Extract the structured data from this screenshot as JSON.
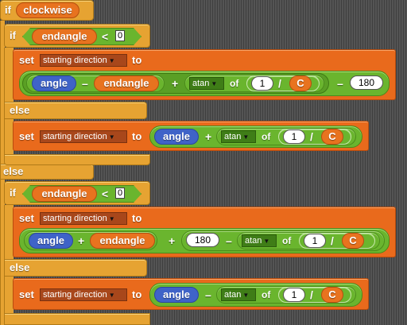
{
  "keywords": {
    "if": "if",
    "else": "else",
    "set": "set",
    "to": "to",
    "of": "of"
  },
  "operators": {
    "lt": "<",
    "minus": "–",
    "plus": "+",
    "div": "/"
  },
  "vars": {
    "clockwise": "clockwise",
    "endangle": "endangle",
    "angle": "angle",
    "c": "C"
  },
  "dropdowns": {
    "starting_direction": "starting direction",
    "atan": "atan"
  },
  "numbers": {
    "zero": "0",
    "one": "1",
    "n180": "180"
  },
  "colors": {
    "control": "#e6a332",
    "variables": "#e96a1c",
    "operators": "#6ab52e",
    "motion": "#3f63c8"
  }
}
